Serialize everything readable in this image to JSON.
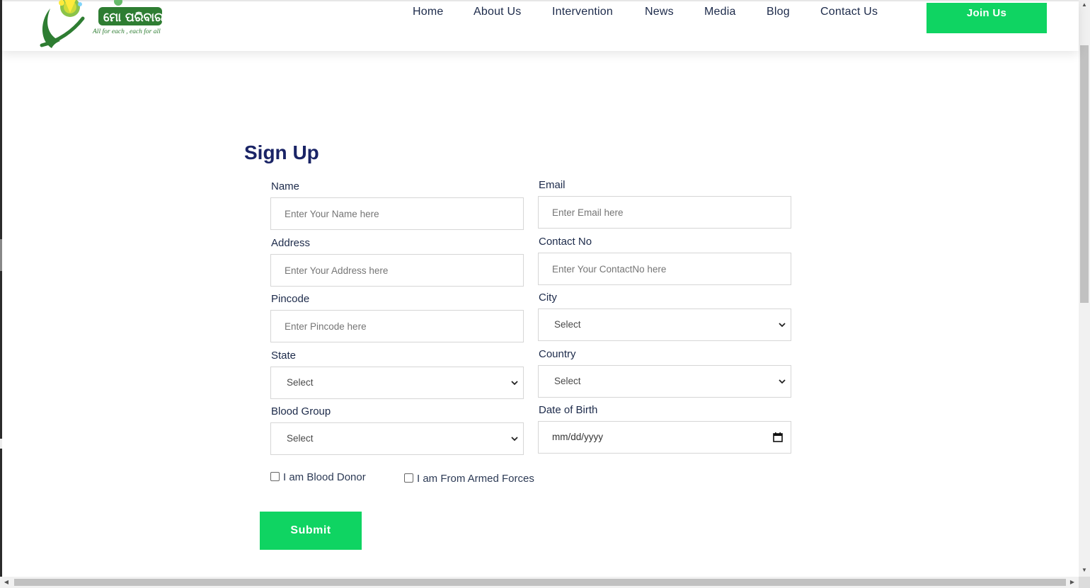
{
  "brand": {
    "name": "ମୋ ପରିବାର",
    "tagline": "All for each , each for all",
    "logo_color": "#2e7d32"
  },
  "nav": {
    "items": [
      "Home",
      "About Us",
      "Intervention",
      "News",
      "Media",
      "Blog",
      "Contact Us"
    ],
    "join_label": "Join Us"
  },
  "form": {
    "title": "Sign Up",
    "name": {
      "label": "Name",
      "placeholder": "Enter Your Name here"
    },
    "email": {
      "label": "Email",
      "placeholder": "Enter Email here"
    },
    "address": {
      "label": "Address",
      "placeholder": "Enter Your Address here"
    },
    "contact": {
      "label": "Contact No",
      "placeholder": "Enter Your ContactNo here"
    },
    "pincode": {
      "label": "Pincode",
      "placeholder": "Enter Pincode here"
    },
    "city": {
      "label": "City",
      "value": "Select"
    },
    "state": {
      "label": "State",
      "value": "Select"
    },
    "country": {
      "label": "Country",
      "value": "Select"
    },
    "blood_group": {
      "label": "Blood Group",
      "value": "Select"
    },
    "dob": {
      "label": "Date of Birth",
      "value": "mm/dd/yyyy"
    },
    "blood_donor_label": "I am Blood Donor",
    "armed_forces_label": "I am From Armed Forces",
    "submit_label": "Submit"
  },
  "colors": {
    "accent_green": "#0fd462",
    "title_navy": "#1a2466",
    "nav_text": "#1c2a4a"
  }
}
